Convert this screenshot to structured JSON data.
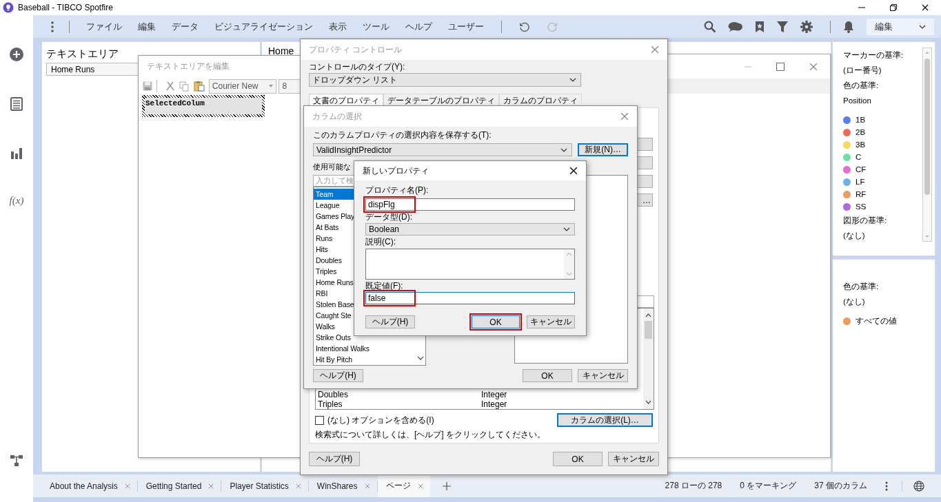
{
  "window": {
    "title": "Baseball - TIBCO Spotfire"
  },
  "rail": {
    "function_label": "f(x)"
  },
  "menu_bar": {
    "items": [
      "ファイル",
      "編集",
      "データ",
      "ビジュアライゼーション",
      "表示",
      "ツール",
      "ヘルプ",
      "ユーザー"
    ],
    "mode": "編集"
  },
  "canvas": {
    "text_area": {
      "title": "テキストエリア",
      "dropdown": "Home Runs"
    },
    "visualization": {
      "title": "Home"
    }
  },
  "legend": {
    "panels": [
      {
        "entries": [
          {
            "kind": "label",
            "text": "マーカーの基準:"
          },
          {
            "kind": "value",
            "text": "(ロー番号)"
          },
          {
            "kind": "label",
            "text": "色の基準:"
          },
          {
            "kind": "value",
            "text": "Position"
          },
          {
            "kind": "swatch",
            "text": "1B",
            "color": "#5b7ff0"
          },
          {
            "kind": "swatch",
            "text": "2B",
            "color": "#f06a5a"
          },
          {
            "kind": "swatch",
            "text": "3B",
            "color": "#f7d95a"
          },
          {
            "kind": "swatch",
            "text": "C",
            "color": "#6ee0a0"
          },
          {
            "kind": "swatch",
            "text": "CF",
            "color": "#e86ad8"
          },
          {
            "kind": "swatch",
            "text": "LF",
            "color": "#6ab4ea"
          },
          {
            "kind": "swatch",
            "text": "RF",
            "color": "#f29a5a"
          },
          {
            "kind": "swatch",
            "text": "SS",
            "color": "#b06ae0"
          },
          {
            "kind": "label",
            "text": "図形の基準:"
          },
          {
            "kind": "value",
            "text": "(なし)"
          }
        ]
      },
      {
        "entries": [
          {
            "kind": "label",
            "text": "色の基準:"
          },
          {
            "kind": "value",
            "text": "(なし)"
          },
          {
            "kind": "swatch",
            "text": "すべての値",
            "color": "#f29a5a"
          }
        ]
      }
    ]
  },
  "page_tabs": [
    {
      "label": "About the Analysis",
      "selected": false
    },
    {
      "label": "Getting Started",
      "selected": false
    },
    {
      "label": "Player Statistics",
      "selected": false
    },
    {
      "label": "WinShares",
      "selected": false
    },
    {
      "label": "ページ",
      "selected": true
    }
  ],
  "status_bar": [
    "278 ローの 278",
    "0 をマーキング",
    "37 個のカラム"
  ],
  "text_editor": {
    "title": "テキストエリアを編集",
    "font": "Courier New",
    "font_size": "8",
    "content": "SelectedColum"
  },
  "property_control": {
    "title": "プロパティ コントロール",
    "type_label": "コントロールのタイプ(Y):",
    "type_value": "ドロップダウン リスト",
    "tabs": [
      {
        "label": "文書のプロパティ",
        "selected": true
      },
      {
        "label": "データテーブルのプロパティ",
        "selected": false
      },
      {
        "label": "カラムのプロパティ",
        "selected": false
      }
    ],
    "side_button": "…",
    "rows": [
      {
        "name": "Doubles",
        "type": "Integer"
      },
      {
        "name": "Triples",
        "type": "Integer"
      }
    ],
    "include_none": {
      "label": "(なし) オプションを含める(I)",
      "checked": false
    },
    "select_columns": "カラムの選択(L)…",
    "hint": "検索式について詳しくは、[ヘルプ] をクリックしてください。",
    "buttons": [
      "ヘルプ(H)",
      "OK",
      "キャンセル"
    ]
  },
  "column_select": {
    "title": "カラムの選択",
    "save_label": "このカラムプロパティの選択内容を保存する(T):",
    "property": "ValidInsightPredictor",
    "new_button": "新規(N)…",
    "available_label": "使用可能な",
    "search_placeholder": "入力して検",
    "columns": [
      {
        "name": "Team",
        "selected": true
      },
      {
        "name": "League",
        "selected": false
      },
      {
        "name": "Games Play",
        "selected": false
      },
      {
        "name": "At Bats",
        "selected": false
      },
      {
        "name": "Runs",
        "selected": false
      },
      {
        "name": "Hits",
        "selected": false
      },
      {
        "name": "Doubles",
        "selected": false
      },
      {
        "name": "Triples",
        "selected": false
      },
      {
        "name": "Home Runs",
        "selected": false
      },
      {
        "name": "RBI",
        "selected": false
      },
      {
        "name": "Stolen Base",
        "selected": false
      },
      {
        "name": "Caught Ste",
        "selected": false
      },
      {
        "name": "Walks",
        "selected": false
      },
      {
        "name": "Strike Outs",
        "selected": false
      },
      {
        "name": "Intentional Walks",
        "selected": false
      },
      {
        "name": "Hit By Pitch",
        "selected": false
      }
    ],
    "buttons": [
      "ヘルプ(H)",
      "OK",
      "キャンセル"
    ]
  },
  "new_property": {
    "title": "新しいプロパティ",
    "name": {
      "label": "プロパティ名(P):",
      "value": "dispFlg",
      "highlighted": true
    },
    "data_type": {
      "label": "データ型(D):",
      "value": "Boolean"
    },
    "description": {
      "label": "説明(C):"
    },
    "default": {
      "label": "既定値(F):",
      "value": "false",
      "highlighted": true
    },
    "buttons": [
      {
        "label": "ヘルプ(H)",
        "highlighted": false
      },
      {
        "label": "OK",
        "highlighted": true
      },
      {
        "label": "キャンセル",
        "highlighted": false
      }
    ]
  }
}
